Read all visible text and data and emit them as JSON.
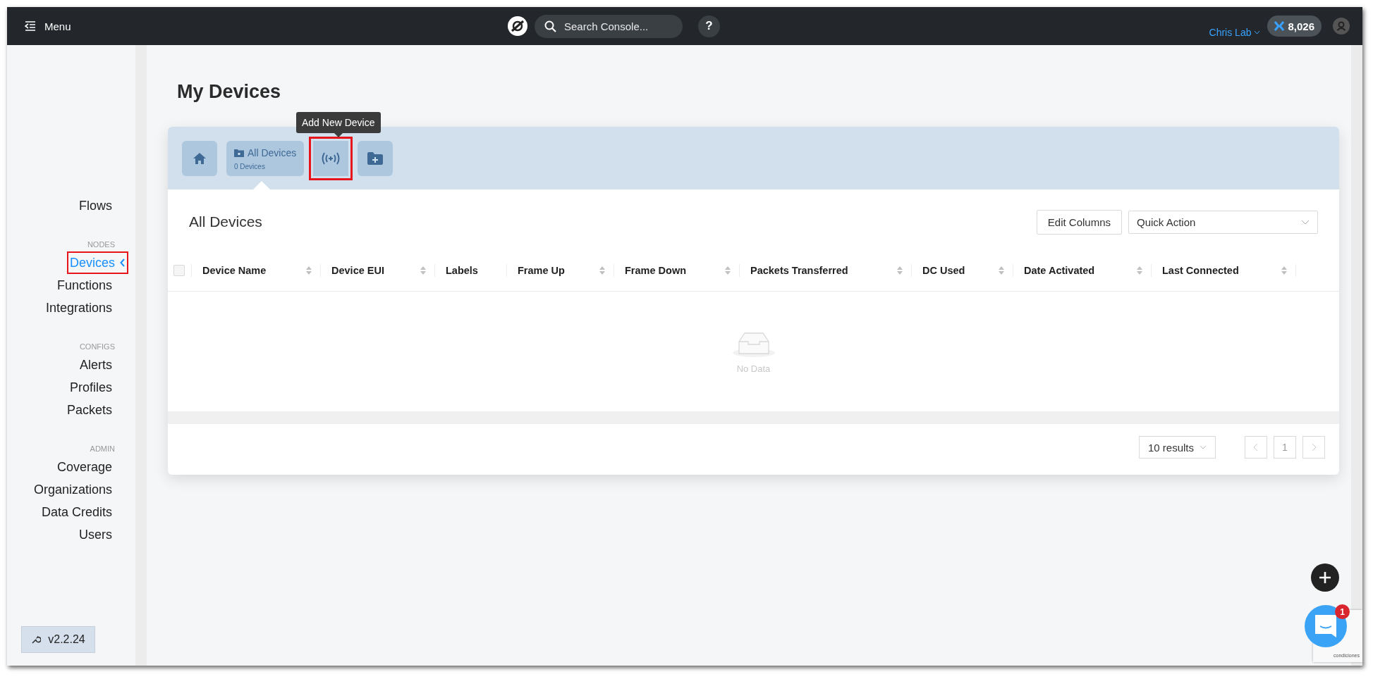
{
  "top_bar": {
    "menu_label": "Menu",
    "search": {
      "placeholder": "Search Console..."
    },
    "help": "?",
    "org": "Chris Lab",
    "balance": "8,026"
  },
  "sidebar": {
    "sections": [
      {
        "items": [
          {
            "label": "Flows",
            "selected": false,
            "highlighted": false
          }
        ]
      },
      {
        "heading": "NODES",
        "items": [
          {
            "label": "Devices",
            "selected": true,
            "highlighted": true
          },
          {
            "label": "Functions",
            "selected": false,
            "highlighted": false
          },
          {
            "label": "Integrations",
            "selected": false,
            "highlighted": false
          }
        ]
      },
      {
        "heading": "CONFIGS",
        "items": [
          {
            "label": "Alerts",
            "selected": false,
            "highlighted": false
          },
          {
            "label": "Profiles",
            "selected": false,
            "highlighted": false
          },
          {
            "label": "Packets",
            "selected": false,
            "highlighted": false
          }
        ]
      },
      {
        "heading": "ADMIN",
        "items": [
          {
            "label": "Coverage",
            "selected": false,
            "highlighted": false
          },
          {
            "label": "Organizations",
            "selected": false,
            "highlighted": false
          },
          {
            "label": "Data Credits",
            "selected": false,
            "highlighted": false
          },
          {
            "label": "Users",
            "selected": false,
            "highlighted": false
          }
        ]
      }
    ],
    "version": "v2.2.24"
  },
  "page": {
    "title": "My Devices"
  },
  "toolbar": {
    "tooltip": "Add New Device",
    "buttons": [
      {
        "kind": "home",
        "highlighted": false
      },
      {
        "kind": "group",
        "label": "All Devices",
        "count": "0 Devices",
        "highlighted": false
      },
      {
        "kind": "add-device",
        "highlighted": true
      },
      {
        "kind": "add-folder",
        "highlighted": false
      }
    ]
  },
  "table": {
    "title": "All Devices",
    "select_all": {
      "checked": false
    },
    "edit_columns": "Edit Columns",
    "quick_action": {
      "placeholder": "Quick Action"
    },
    "columns": [
      {
        "label": "Device Name",
        "sortable": true
      },
      {
        "label": "Device EUI",
        "sortable": true
      },
      {
        "label": "Labels",
        "sortable": false
      },
      {
        "label": "Frame Up",
        "sortable": true
      },
      {
        "label": "Frame Down",
        "sortable": true
      },
      {
        "label": "Packets Transferred",
        "sortable": true
      },
      {
        "label": "DC Used",
        "sortable": true
      },
      {
        "label": "Date Activated",
        "sortable": true
      },
      {
        "label": "Last Connected",
        "sortable": true
      }
    ],
    "empty_text": "No Data"
  },
  "pagination": {
    "page_size": "10 results",
    "current_page": "1"
  },
  "chat": {
    "badge": "1"
  },
  "recaptcha": {
    "text": "condiciones"
  }
}
